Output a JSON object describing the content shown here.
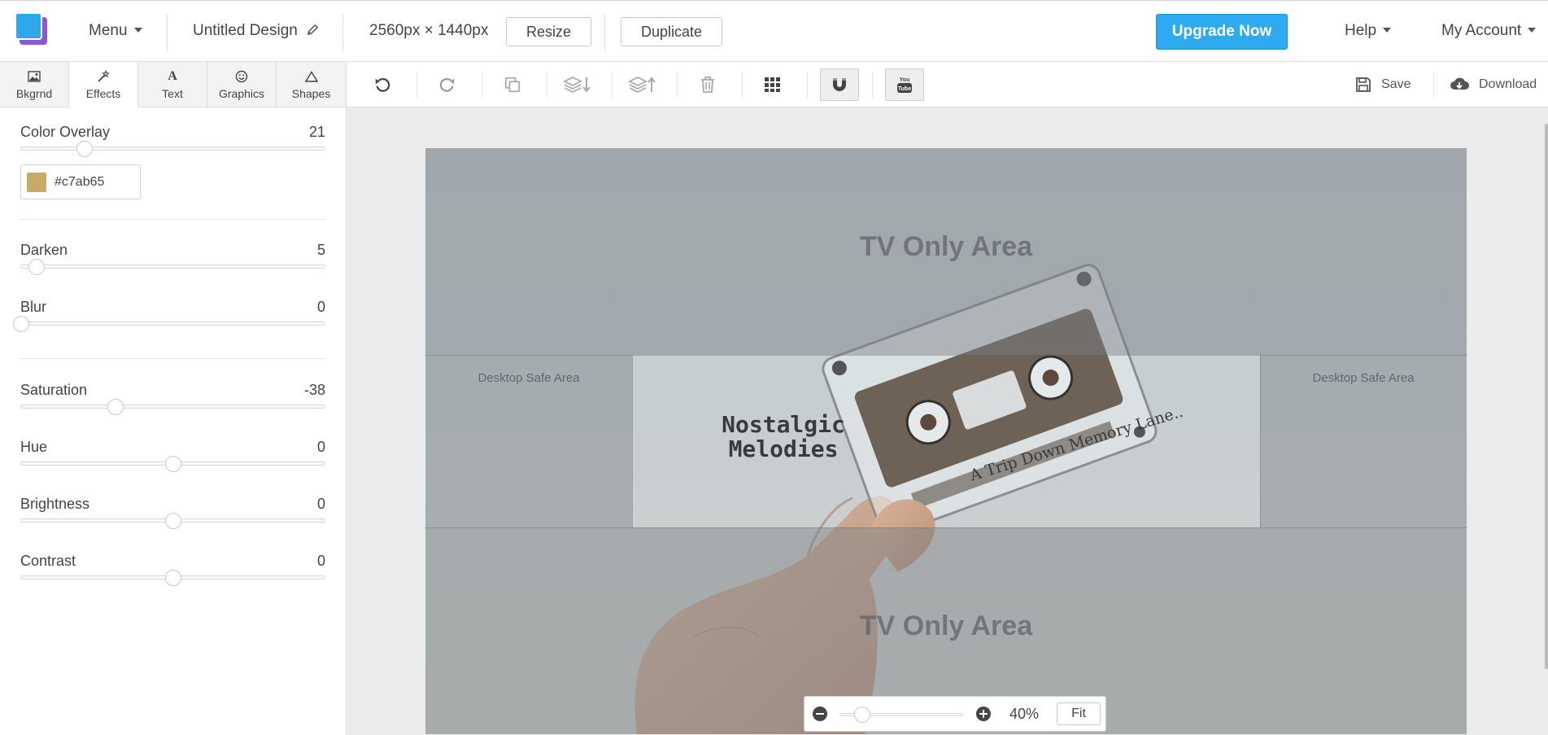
{
  "header": {
    "menu_label": "Menu",
    "design_name": "Untitled Design",
    "canvas_size": "2560px × 1440px",
    "resize_label": "Resize",
    "duplicate_label": "Duplicate",
    "upgrade_label": "Upgrade Now",
    "help_label": "Help",
    "account_label": "My Account"
  },
  "toolbar": {
    "save_label": "Save",
    "download_label": "Download",
    "icons": [
      "undo-icon",
      "redo-icon",
      "duplicate-icon",
      "send-backward-icon",
      "bring-forward-icon",
      "trash-icon",
      "grid-icon",
      "magnet-icon",
      "youtube-icon"
    ]
  },
  "sidebar": {
    "tabs": [
      {
        "label": "Bkgrnd",
        "icon": "image-icon"
      },
      {
        "label": "Effects",
        "icon": "magic-wand-icon"
      },
      {
        "label": "Text",
        "icon": "text-icon"
      },
      {
        "label": "Graphics",
        "icon": "smiley-icon"
      },
      {
        "label": "Shapes",
        "icon": "triangle-icon"
      }
    ],
    "active_tab": "Effects",
    "color_overlay": {
      "label": "Color Overlay",
      "value": "21",
      "level": 21,
      "color": "#c7ab65",
      "color_text": "#c7ab65"
    },
    "darken": {
      "label": "Darken",
      "value": "5",
      "level": 5
    },
    "blur": {
      "label": "Blur",
      "value": "0",
      "level": 0
    },
    "saturation": {
      "label": "Saturation",
      "value": "-38",
      "level": -38
    },
    "hue": {
      "label": "Hue",
      "value": "0",
      "level": 0
    },
    "brightness": {
      "label": "Brightness",
      "value": "0",
      "level": 0
    },
    "contrast": {
      "label": "Contrast",
      "value": "0",
      "level": 0
    }
  },
  "canvas": {
    "tv_top_label": "TV Only Area",
    "tv_bottom_label": "TV Only Area",
    "desktop_left_label": "Desktop Safe Area",
    "desktop_right_label": "Desktop Safe Area",
    "title_line1": "Nostalgic",
    "title_line2": "Melodies",
    "subtitle": "A Trip Down Memory Lane..",
    "cassette_text": "A Trip Down Memory Lane"
  },
  "zoom": {
    "value": "40%",
    "level": 0.18,
    "fit_label": "Fit"
  },
  "colors": {
    "accent": "#2fa9ef",
    "logo_blue": "#2fa7ea",
    "logo_purple": "#8b56d8",
    "overlay_swatch": "#c7ab65"
  }
}
